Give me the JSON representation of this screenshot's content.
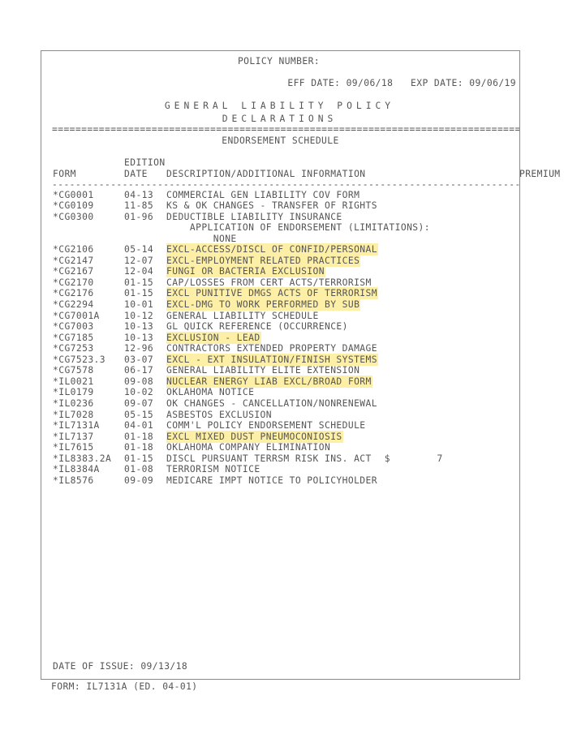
{
  "header": {
    "policy_number_label": "POLICY NUMBER:",
    "eff_date_label": "EFF DATE:",
    "eff_date_value": "09/06/18",
    "exp_date_label": "EXP DATE:",
    "exp_date_value": "09/06/19",
    "dates_line": "EFF DATE: 09/06/18   EXP DATE: 09/06/19",
    "title_line1": "GENERAL LIABILITY POLICY",
    "title_line2": "DECLARATIONS",
    "section_title": "ENDORSEMENT SCHEDULE",
    "equals_rule": "================================================================================",
    "dash_rule": "--------------------------------------------------------------------------------"
  },
  "table": {
    "headers": {
      "form": "FORM",
      "edition": "EDITION",
      "date": "DATE",
      "description": "DESCRIPTION/ADDITIONAL INFORMATION",
      "premium": "PREMIUM"
    },
    "rows": [
      {
        "form": "*CG0001",
        "date": "04-13",
        "description": "COMMERCIAL GEN LIABILITY COV FORM",
        "highlight": false
      },
      {
        "form": "*CG0109",
        "date": "11-85",
        "description": "KS & OK CHANGES - TRANSFER OF RIGHTS",
        "highlight": false
      },
      {
        "form": "*CG0300",
        "date": "01-96",
        "description": "DEDUCTIBLE LIABILITY INSURANCE",
        "highlight": false
      },
      {
        "form": "",
        "date": "",
        "description": "APPLICATION OF ENDORSEMENT (LIMITATIONS):",
        "highlight": false,
        "indent": 1
      },
      {
        "form": "",
        "date": "",
        "description": "NONE",
        "highlight": false,
        "indent": 2
      },
      {
        "form": "*CG2106",
        "date": "05-14",
        "description": "EXCL-ACCESS/DISCL OF CONFID/PERSONAL",
        "highlight": true
      },
      {
        "form": "*CG2147",
        "date": "12-07",
        "description": "EXCL-EMPLOYMENT RELATED PRACTICES",
        "highlight": true
      },
      {
        "form": "*CG2167",
        "date": "12-04",
        "description": "FUNGI OR BACTERIA EXCLUSION",
        "highlight": true
      },
      {
        "form": "*CG2170",
        "date": "01-15",
        "description": "CAP/LOSSES FROM CERT ACTS/TERRORISM",
        "highlight": false
      },
      {
        "form": "*CG2176",
        "date": "01-15",
        "description": "EXCL PUNITIVE DMGS ACTS OF TERRORISM",
        "highlight": true
      },
      {
        "form": "*CG2294",
        "date": "10-01",
        "description": "EXCL-DMG TO WORK PERFORMED BY SUB",
        "highlight": true
      },
      {
        "form": "*CG7001A",
        "date": "10-12",
        "description": "GENERAL LIABILITY SCHEDULE",
        "highlight": false
      },
      {
        "form": "*CG7003",
        "date": "10-13",
        "description": "GL QUICK REFERENCE (OCCURRENCE)",
        "highlight": false
      },
      {
        "form": "*CG7185",
        "date": "10-13",
        "description": "EXCLUSION - LEAD",
        "highlight": true
      },
      {
        "form": "*CG7253",
        "date": "12-96",
        "description": "CONTRACTORS EXTENDED PROPERTY DAMAGE",
        "highlight": false
      },
      {
        "form": "*CG7523.3",
        "date": "03-07",
        "description": "EXCL - EXT INSULATION/FINISH SYSTEMS",
        "highlight": true
      },
      {
        "form": "*CG7578",
        "date": "06-17",
        "description": "GENERAL LIABILITY ELITE EXTENSION",
        "highlight": false
      },
      {
        "form": "*IL0021",
        "date": "09-08",
        "description": "NUCLEAR ENERGY LIAB EXCL/BROAD FORM",
        "highlight": true
      },
      {
        "form": "*IL0179",
        "date": "10-02",
        "description": "OKLAHOMA NOTICE",
        "highlight": false
      },
      {
        "form": "*IL0236",
        "date": "09-07",
        "description": "OK CHANGES - CANCELLATION/NONRENEWAL",
        "highlight": false
      },
      {
        "form": "*IL7028",
        "date": "05-15",
        "description": "ASBESTOS EXCLUSION",
        "highlight": false
      },
      {
        "form": "*IL7131A",
        "date": "04-01",
        "description": "COMM'L POLICY ENDORSEMENT SCHEDULE",
        "highlight": false
      },
      {
        "form": "*IL7137",
        "date": "01-18",
        "description": "EXCL MIXED DUST PNEUMOCONIOSIS",
        "highlight": true
      },
      {
        "form": "*IL7615",
        "date": "01-18",
        "description": "OKLAHOMA COMPANY ELIMINATION",
        "highlight": false
      },
      {
        "form": "*IL8383.2A",
        "date": "01-15",
        "description": "DISCL PURSUANT TERRSM RISK INS. ACT",
        "highlight": false,
        "premium_symbol": "$",
        "premium_amount": "7"
      },
      {
        "form": "*IL8384A",
        "date": "01-08",
        "description": "TERRORISM NOTICE",
        "highlight": false
      },
      {
        "form": "*IL8576",
        "date": "09-09",
        "description": "MEDICARE IMPT NOTICE TO POLICYHOLDER",
        "highlight": false
      }
    ]
  },
  "footer": {
    "date_of_issue_label": "DATE OF ISSUE:",
    "date_of_issue_value": "09/13/18",
    "date_of_issue_line": "DATE OF ISSUE: 09/13/18",
    "form_line": "FORM: IL7131A (ED. 04-01)"
  },
  "colors": {
    "highlight": "#fdefa6",
    "text": "#555555",
    "border": "#8a8a8a",
    "background": "#ffffff"
  }
}
